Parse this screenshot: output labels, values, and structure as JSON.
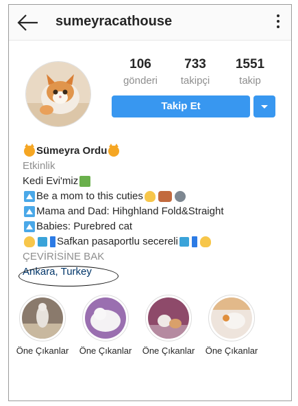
{
  "header": {
    "username": "sumeyracathouse",
    "back_icon": "arrow-left-icon",
    "menu_icon": "more-vertical-icon"
  },
  "stats": [
    {
      "value": "106",
      "label": "gönderi"
    },
    {
      "value": "733",
      "label": "takipçi"
    },
    {
      "value": "1551",
      "label": "takip"
    }
  ],
  "follow": {
    "label": "Takip Et",
    "dropdown_icon": "chevron-down-icon",
    "color": "#3897f0"
  },
  "bio": {
    "name": "Sümeyra Ordu",
    "category": "Etkinlik",
    "line1": "Kedi Evi'miz",
    "line2": "Be a mom to this cuties",
    "line3": "Mama and Dad:  Hihghland Fold&Straight",
    "line4": "Babies: Purebred cat",
    "line5": "Safkan  pasaportlu secereli",
    "translate": "ÇEVİRİSİNE BAK",
    "location": "Ankara, Turkey"
  },
  "highlights": [
    {
      "label": "Öne Çıkanlar"
    },
    {
      "label": "Öne Çıkanlar"
    },
    {
      "label": "Öne Çıkanlar"
    },
    {
      "label": "Öne Çıkanlar"
    }
  ],
  "colors": {
    "link": "#003569",
    "muted": "#8e8e8e",
    "text": "#262626"
  }
}
